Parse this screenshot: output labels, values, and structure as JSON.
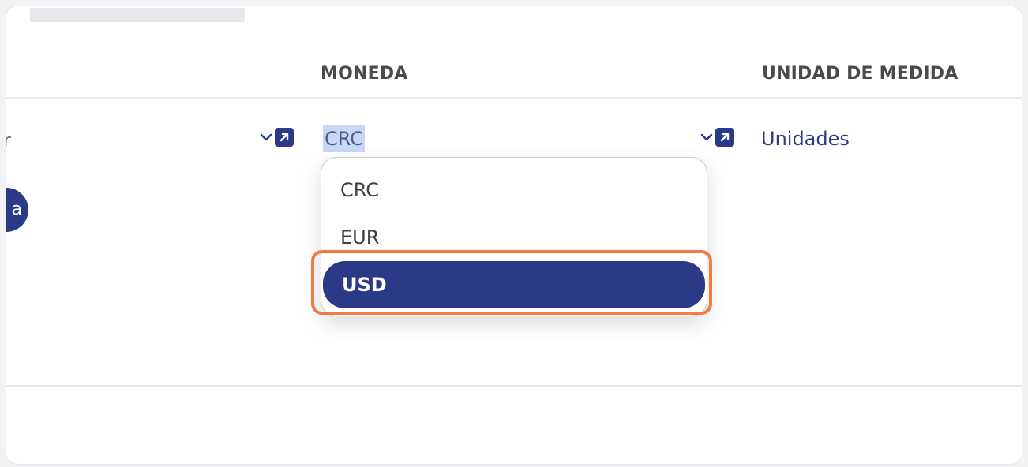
{
  "table": {
    "columns": {
      "moneda": "MONEDA",
      "unidad_de_medida": "UNIDAD DE MEDIDA"
    },
    "row": {
      "cut_text": "r",
      "moneda_value": "CRC",
      "unidad_value": "Unidades",
      "round_button_label": "a"
    }
  },
  "dropdown": {
    "options": [
      "CRC",
      "EUR",
      "USD"
    ],
    "selected": "USD"
  },
  "icons": {
    "chevron": "chevron-down-icon",
    "external": "external-link-icon"
  },
  "colors": {
    "brand": "#2b3a86",
    "highlight": "#f07b45",
    "selection": "#c5d9f7"
  }
}
